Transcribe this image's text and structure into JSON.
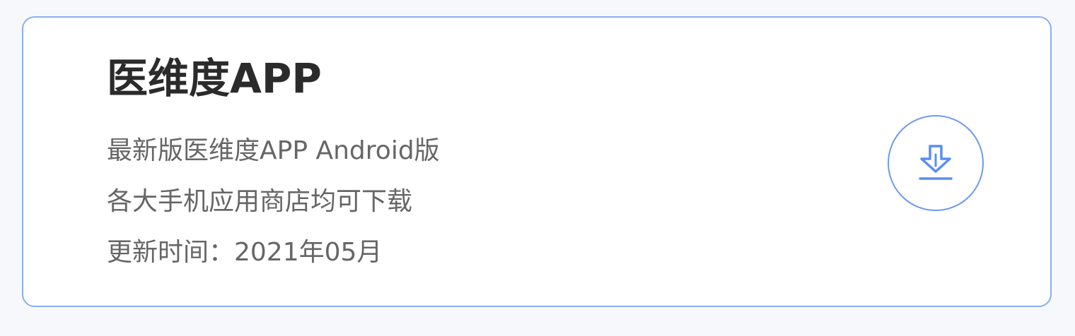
{
  "card": {
    "title": "医维度APP",
    "line1": "最新版医维度APP Android版",
    "line2": "各大手机应用商店均可下载",
    "line3": "更新时间：2021年05月"
  },
  "download_button": {
    "icon": "download-icon",
    "color": "#5b8ef0"
  },
  "colors": {
    "border": "#8aaef0",
    "title": "#2b2b2b",
    "text": "#666666",
    "accent": "#5b8ef0"
  }
}
